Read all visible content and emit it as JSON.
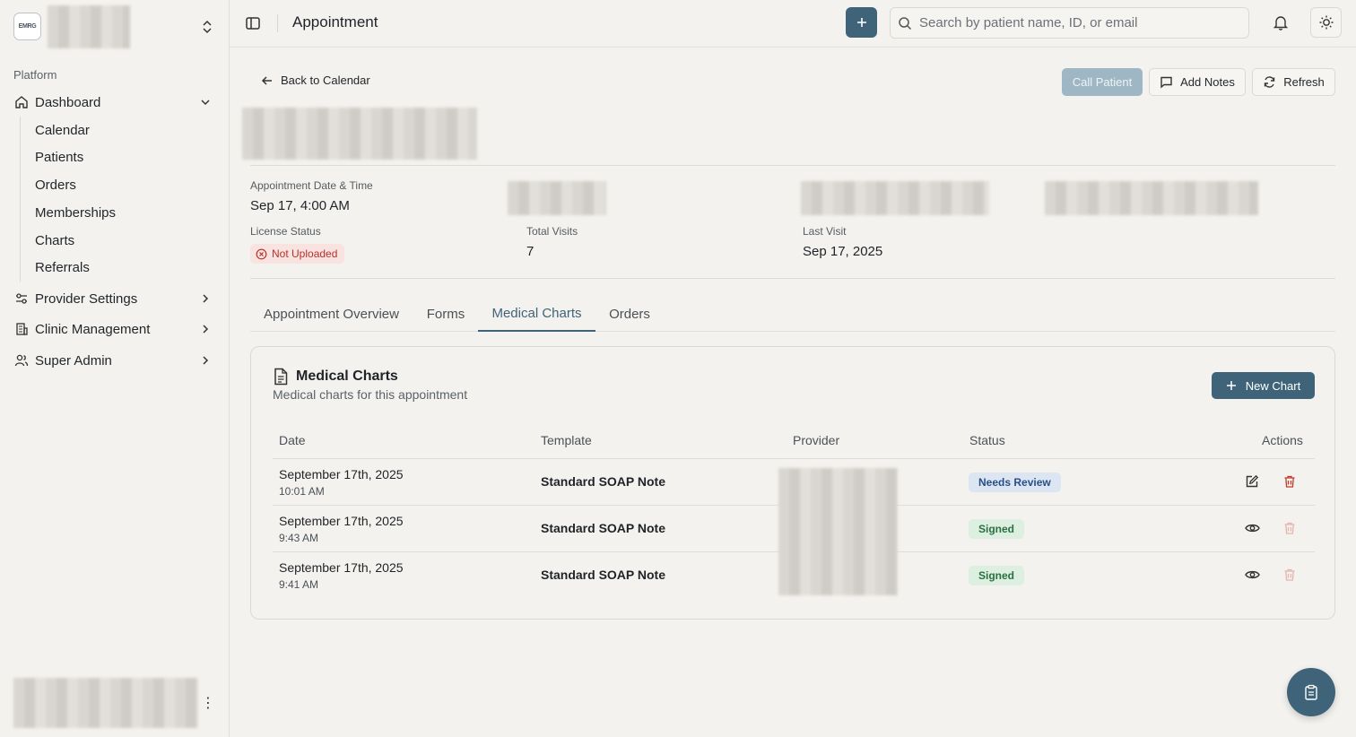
{
  "brand": {
    "logo_text": "EMRG"
  },
  "sidebar": {
    "section_label": "Platform",
    "dashboard": "Dashboard",
    "sub_items": [
      "Calendar",
      "Patients",
      "Orders",
      "Memberships",
      "Charts",
      "Referrals"
    ],
    "provider_settings": "Provider Settings",
    "clinic_management": "Clinic Management",
    "super_admin": "Super Admin"
  },
  "header": {
    "title": "Appointment",
    "search_placeholder": "Search by patient name, ID, or email"
  },
  "toolbar": {
    "back": "Back to Calendar",
    "call": "Call Patient",
    "notes": "Add Notes",
    "refresh": "Refresh"
  },
  "info": {
    "appt_label": "Appointment Date & Time",
    "appt_value": "Sep 17, 4:00 AM",
    "license_label": "License Status",
    "license_value": "Not Uploaded",
    "visits_label": "Total Visits",
    "visits_value": "7",
    "last_label": "Last Visit",
    "last_value": "Sep 17, 2025"
  },
  "tabs": [
    "Appointment Overview",
    "Forms",
    "Medical Charts",
    "Orders"
  ],
  "charts_card": {
    "title": "Medical Charts",
    "subtitle": "Medical charts for this appointment",
    "new_button": "New Chart",
    "columns": [
      "Date",
      "Template",
      "Provider",
      "Status",
      "Actions"
    ],
    "rows": [
      {
        "date": "September 17th, 2025",
        "time": "10:01 AM",
        "template": "Standard SOAP Note",
        "status": "Needs Review"
      },
      {
        "date": "September 17th, 2025",
        "time": "9:43 AM",
        "template": "Standard SOAP Note",
        "status": "Signed"
      },
      {
        "date": "September 17th, 2025",
        "time": "9:41 AM",
        "template": "Standard SOAP Note",
        "status": "Signed"
      }
    ]
  },
  "colors": {
    "accent": "#3f6479",
    "danger": "#b4322b",
    "background": "#f4f2ee"
  }
}
